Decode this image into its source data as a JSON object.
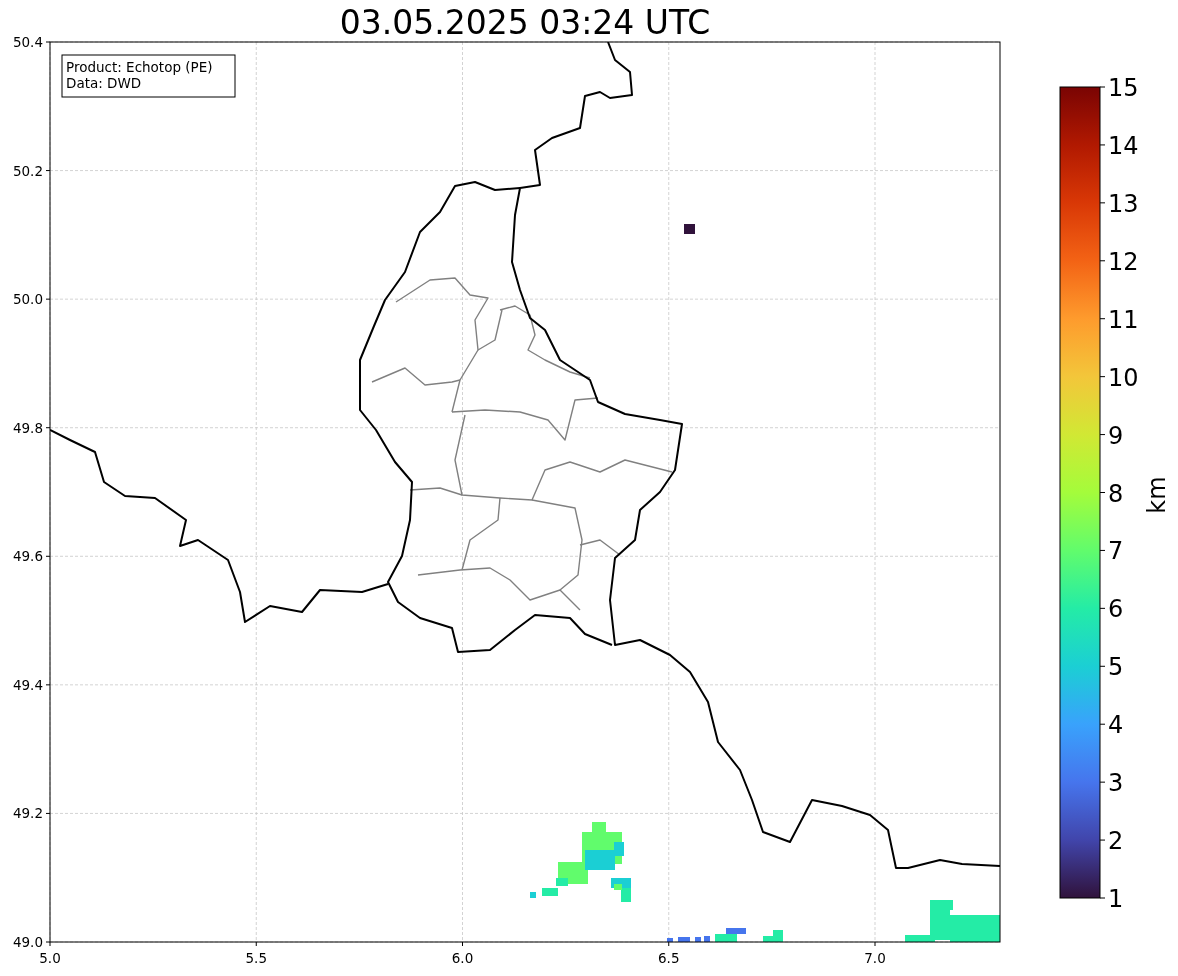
{
  "title": "03.05.2025 03:24 UTC",
  "info_box": {
    "lines": [
      "Product: Echotop (PE)",
      "Data: DWD"
    ]
  },
  "map": {
    "x_ticks": [
      "5.0",
      "5.5",
      "6.0",
      "6.5",
      "7.0"
    ],
    "y_ticks": [
      "50.4",
      "50.2",
      "50.0",
      "49.8",
      "49.6",
      "49.4",
      "49.2",
      "49.0"
    ]
  },
  "colorbar": {
    "label": "km",
    "ticks": [
      "15",
      "14",
      "13",
      "12",
      "11",
      "10",
      "9",
      "8",
      "7",
      "6",
      "5",
      "4",
      "3",
      "2",
      "1"
    ]
  }
}
